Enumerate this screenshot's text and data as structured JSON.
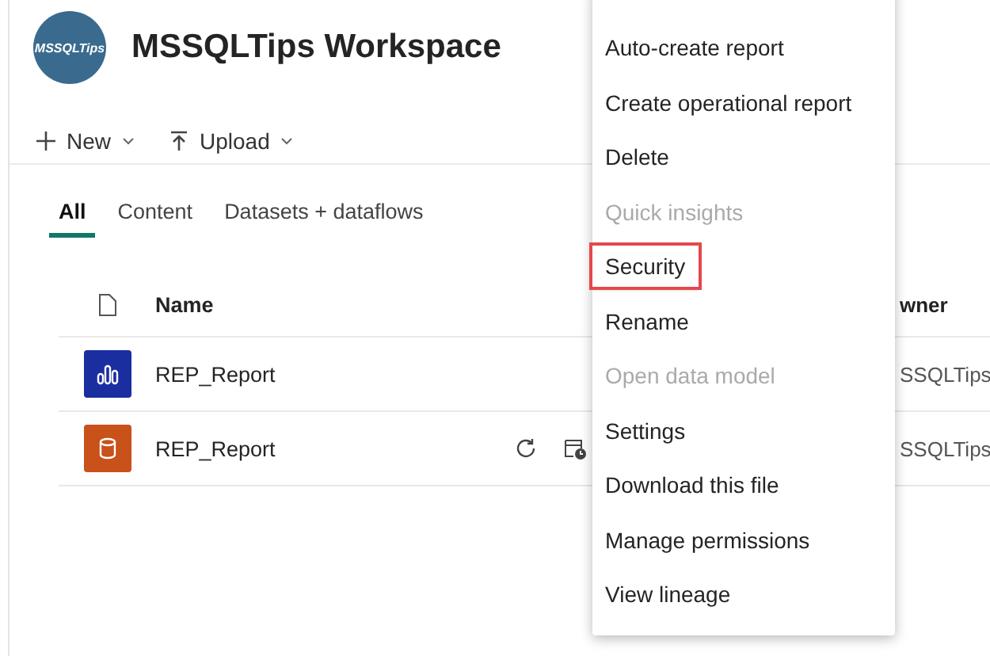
{
  "workspace": {
    "logo_text": "MSSQLTips",
    "title": "MSSQLTips Workspace"
  },
  "toolbar": [
    {
      "kind": "new",
      "label": "New"
    },
    {
      "kind": "upload",
      "label": "Upload"
    }
  ],
  "tabs": [
    {
      "label": "All",
      "selected": true
    },
    {
      "label": "Content",
      "selected": false
    },
    {
      "label": "Datasets + dataflows",
      "selected": false
    }
  ],
  "table": {
    "columns": {
      "name": "Name",
      "owner": "wner"
    },
    "rows": [
      {
        "kind": "report",
        "color": "#1b2ea0",
        "name": "REP_Report",
        "owner": "SSQLTips",
        "actions": false
      },
      {
        "kind": "dataset",
        "color": "#c9511a",
        "name": "REP_Report",
        "owner": "SSQLTips",
        "actions": true
      }
    ]
  },
  "context_menu": [
    {
      "label": "Auto-create report",
      "disabled": false,
      "highlighted": false
    },
    {
      "label": "Create operational report",
      "disabled": false,
      "highlighted": false
    },
    {
      "label": "Delete",
      "disabled": false,
      "highlighted": false
    },
    {
      "label": "Quick insights",
      "disabled": true,
      "highlighted": false
    },
    {
      "label": "Security",
      "disabled": false,
      "highlighted": true
    },
    {
      "label": "Rename",
      "disabled": false,
      "highlighted": false
    },
    {
      "label": "Open data model",
      "disabled": true,
      "highlighted": false
    },
    {
      "label": "Settings",
      "disabled": false,
      "highlighted": false
    },
    {
      "label": "Download this file",
      "disabled": false,
      "highlighted": false
    },
    {
      "label": "Manage permissions",
      "disabled": false,
      "highlighted": false
    },
    {
      "label": "View lineage",
      "disabled": false,
      "highlighted": false
    }
  ]
}
